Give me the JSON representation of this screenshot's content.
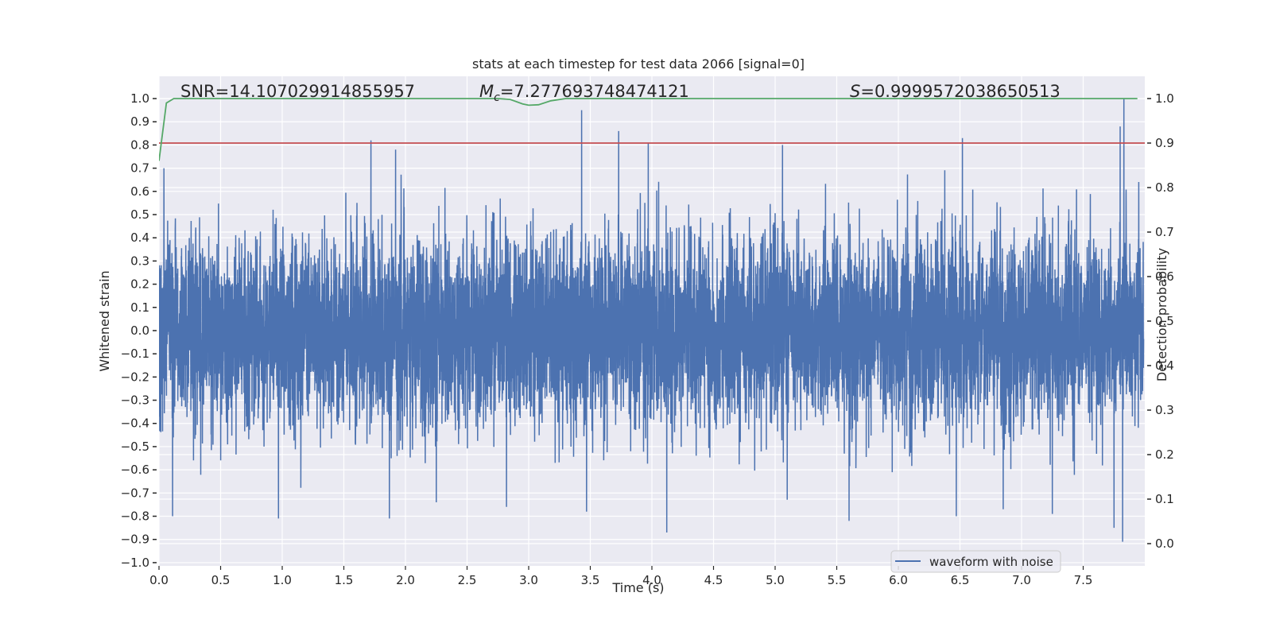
{
  "chart_data": {
    "type": "line",
    "title": "stats at each timestep for test data 2066 [signal=0]",
    "xlabel": "Time (s)",
    "ylabel": "Whitened strain",
    "ylabel_right": "Detection probability",
    "xlim": [
      0,
      8.0
    ],
    "ylim": [
      -1.014,
      1.096
    ],
    "ylim_right": [
      -0.05,
      1.05
    ],
    "grid": true,
    "background": "#EAEAF2",
    "xticks": [
      0.0,
      0.5,
      1.0,
      1.5,
      2.0,
      2.5,
      3.0,
      3.5,
      4.0,
      4.5,
      5.0,
      5.5,
      6.0,
      6.5,
      7.0,
      7.5
    ],
    "yticks": [
      -1.0,
      -0.9,
      -0.8,
      -0.7,
      -0.6,
      -0.5,
      -0.4,
      -0.3,
      -0.2,
      -0.1,
      0.0,
      0.1,
      0.2,
      0.3,
      0.4,
      0.5,
      0.6,
      0.7,
      0.8,
      0.9,
      1.0
    ],
    "yticks_right": [
      0.0,
      0.1,
      0.2,
      0.3,
      0.4,
      0.5,
      0.6,
      0.7,
      0.8,
      0.9,
      1.0
    ],
    "annotations": {
      "snr": "SNR=14.107029914855957",
      "mc_symbol": "M",
      "mc_sub": "c",
      "mc_value": "=7.277693748474121",
      "s_symbol": "S",
      "s_value": "=0.9999572038650513"
    },
    "legend": {
      "position": "lower-right",
      "entries": [
        "waveform with noise"
      ]
    },
    "series": [
      {
        "name": "waveform with noise",
        "axis": "left",
        "color": "#4C72B0",
        "x_range": [
          0,
          7.99
        ],
        "noise_std": 0.2,
        "notable_peaks": [
          [
            0.04,
            0.7
          ],
          [
            1.72,
            0.82
          ],
          [
            1.92,
            0.78
          ],
          [
            3.43,
            0.95
          ],
          [
            3.73,
            0.86
          ],
          [
            3.97,
            0.81
          ],
          [
            5.06,
            0.8
          ],
          [
            6.52,
            0.83
          ],
          [
            7.83,
            1.0
          ],
          [
            7.8,
            0.88
          ],
          [
            0.11,
            -0.8
          ],
          [
            0.97,
            -0.81
          ],
          [
            1.87,
            -0.81
          ],
          [
            2.25,
            -0.74
          ],
          [
            2.82,
            -0.76
          ],
          [
            3.47,
            -0.78
          ],
          [
            4.12,
            -0.87
          ],
          [
            5.6,
            -0.82
          ],
          [
            6.47,
            -0.8
          ],
          [
            7.25,
            -0.79
          ],
          [
            7.75,
            -0.85
          ],
          [
            7.82,
            -0.91
          ]
        ]
      },
      {
        "name": "detection probability",
        "axis": "right",
        "color": "#55A868",
        "x": [
          0.0,
          0.06,
          0.12,
          2.75,
          2.85,
          2.95,
          3.0,
          3.08,
          3.18,
          3.3,
          7.94
        ],
        "y": [
          0.86,
          0.99,
          1.0,
          1.0,
          0.998,
          0.988,
          0.985,
          0.986,
          0.995,
          1.0,
          1.0
        ]
      },
      {
        "name": "threshold",
        "axis": "right",
        "color": "#C44E52",
        "x": [
          0.0,
          8.0
        ],
        "y": [
          0.9,
          0.9
        ]
      }
    ]
  }
}
